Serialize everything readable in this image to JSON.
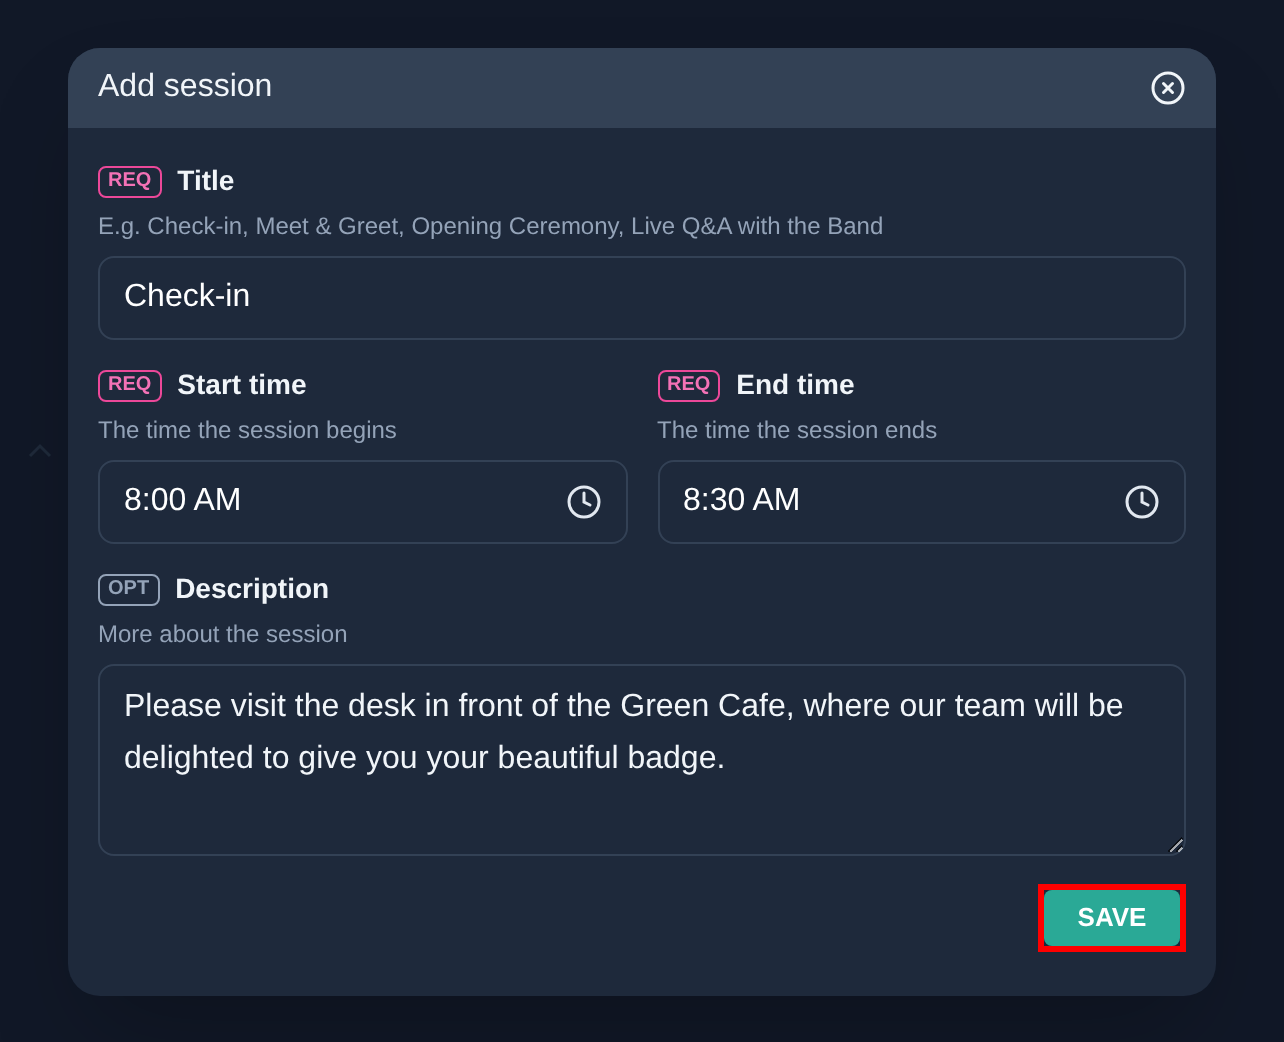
{
  "dialog": {
    "title": "Add session"
  },
  "fields": [
    {
      "kind": "text",
      "tag": "REQ",
      "required": true,
      "label": "Title",
      "hint": "E.g. Check-in, Meet & Greet, Opening Ceremony, Live Q&A with the Band",
      "value": "Check-in"
    },
    {
      "kind": "time",
      "tag": "REQ",
      "required": true,
      "label": "Start time",
      "hint": "The time the session begins",
      "value": "8:00 AM"
    },
    {
      "kind": "time",
      "tag": "REQ",
      "required": true,
      "label": "End time",
      "hint": "The time the session ends",
      "value": "8:30 AM"
    },
    {
      "kind": "textarea",
      "tag": "OPT",
      "required": false,
      "label": "Description",
      "hint": "More about the session",
      "value": "Please visit the desk in front of the Green Cafe, where our team will be delighted to give you your beautiful badge."
    }
  ],
  "save_button": {
    "label": "SAVE",
    "highlighted": true
  }
}
